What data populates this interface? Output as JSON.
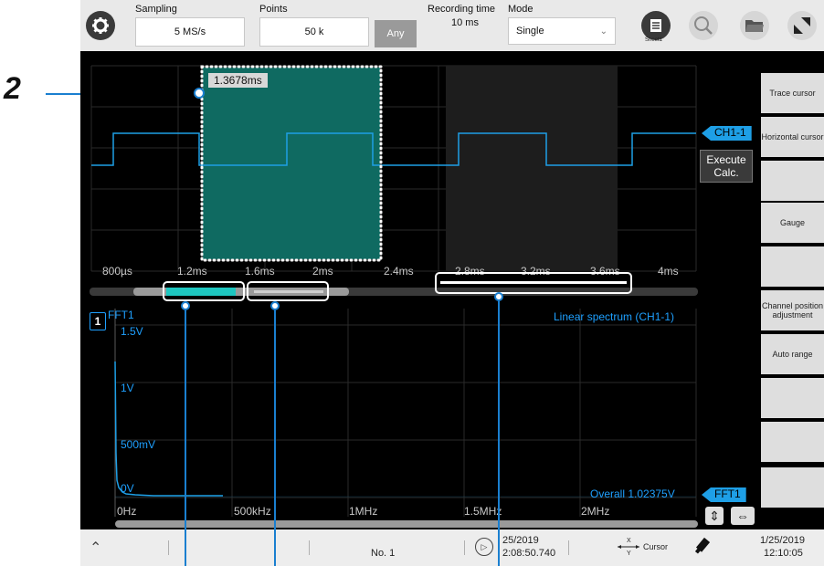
{
  "callout": {
    "number": "2"
  },
  "toolbar": {
    "sampling_label": "Sampling",
    "sampling_value": "5 MS/s",
    "points_label": "Points",
    "points_value": "50 k",
    "any_label": "Any",
    "recording_time_label": "Recording time",
    "recording_time_value": "10 ms",
    "mode_label": "Mode",
    "mode_value": "Single",
    "sheet_label": "Sheet1"
  },
  "waveform": {
    "zoom_time": "1.3678ms",
    "channel_tag": "CH1-1",
    "execute_label": "Execute\nCalc.",
    "x_ticks": [
      "800µs",
      "1.2ms",
      "1.6ms",
      "2ms",
      "2.4ms",
      "2.8ms",
      "3.2ms",
      "3.6ms",
      "4ms"
    ]
  },
  "fft": {
    "sheet_number": "1",
    "name": "FFT1",
    "title": "Linear spectrum (CH1-1)",
    "y_ticks": [
      "1.5V",
      "1V",
      "500mV",
      "0V"
    ],
    "x_ticks": [
      "0Hz",
      "500kHz",
      "1MHz",
      "1.5MHz",
      "2MHz"
    ],
    "overall": "Overall  1.02375V",
    "tag": "FFT1"
  },
  "right_panel": {
    "buttons": [
      "Trace cursor",
      "Horizontal cursor",
      "",
      "Gauge",
      "",
      "Channel position adjustment",
      "Auto range",
      "",
      "",
      ""
    ]
  },
  "status": {
    "file_no": "No. 1",
    "trigger_date": "25/2019",
    "trigger_time": "2:08:50.740",
    "cursor_label": "Cursor",
    "clock_date": "1/25/2019",
    "clock_time": "12:10:05"
  },
  "colors": {
    "waveform": "#1e9fe6",
    "zoom_fill": "#0f6a61",
    "fft_text": "#1ea0ff",
    "callout": "#1a7fd0"
  }
}
